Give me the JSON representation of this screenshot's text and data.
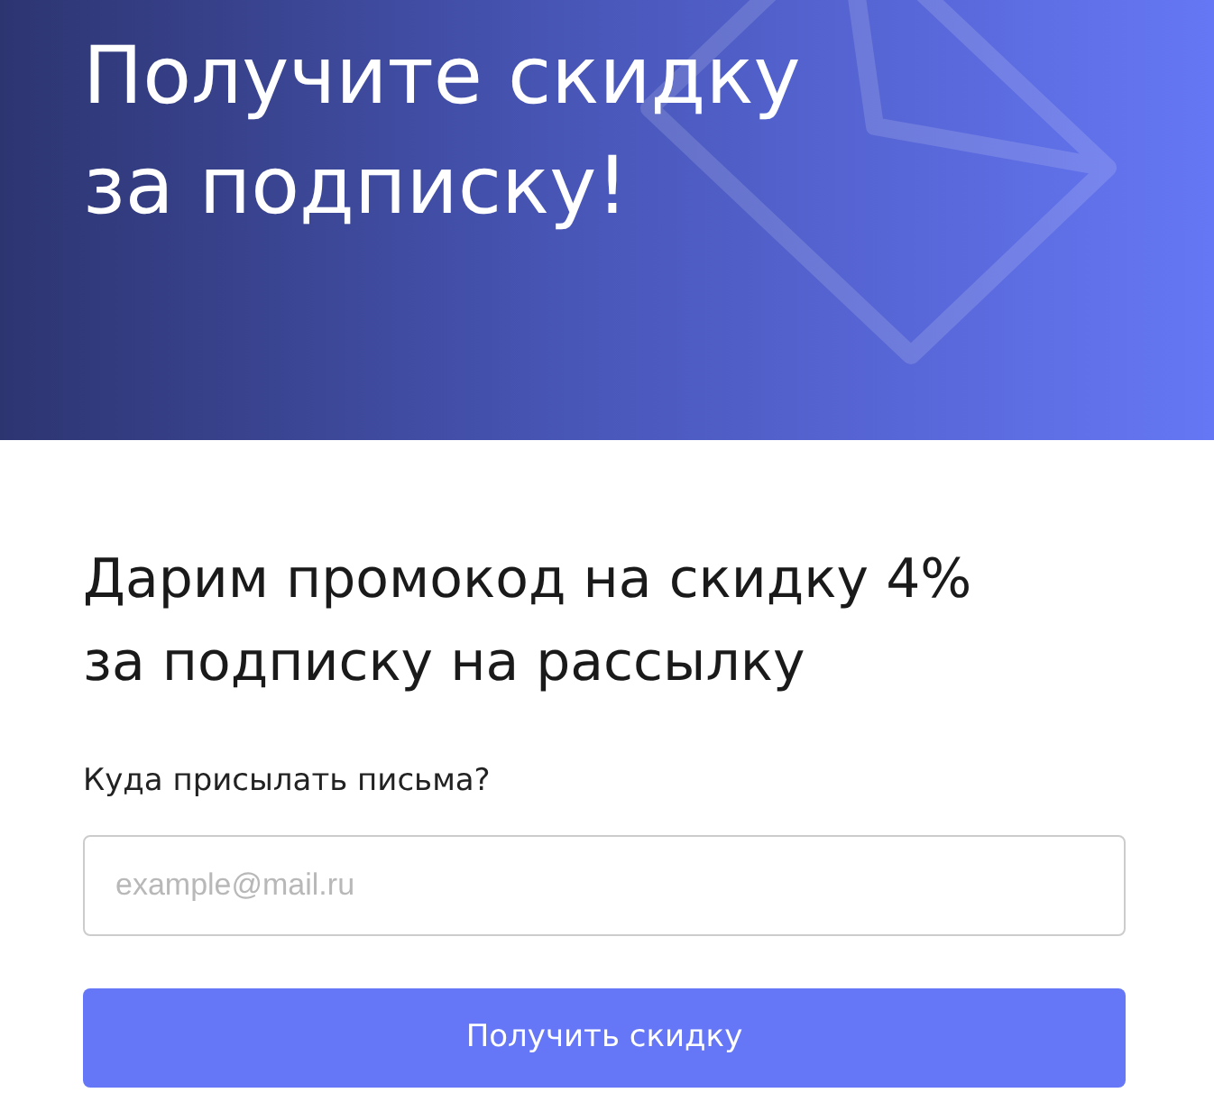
{
  "banner": {
    "title": "Получите скидку\nза подписку!"
  },
  "form": {
    "heading": "Дарим промокод на скидку 4%\nза подписку на рассылку",
    "email_label": "Куда присылать письма?",
    "email_field": {
      "placeholder": "example@mail.ru"
    },
    "submit_button": "Получить скидку"
  }
}
